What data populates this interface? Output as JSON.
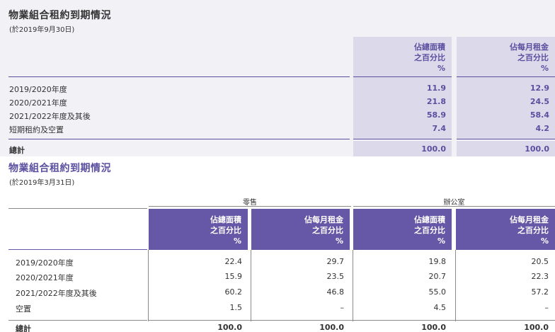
{
  "section1": {
    "title": "物業組合租約到期情況",
    "subtitle": "(於2019年9月30日)",
    "headers": [
      [
        "佔總面積",
        "之百分比",
        "%"
      ],
      [
        "佔每月租金",
        "之百分比",
        "%"
      ]
    ],
    "rows": [
      {
        "label": "2019/2020年度",
        "values": [
          "11.9",
          "12.9"
        ]
      },
      {
        "label": "2020/2021年度",
        "values": [
          "21.8",
          "24.5"
        ]
      },
      {
        "label": "2021/2022年度及其後",
        "values": [
          "58.9",
          "58.4"
        ]
      },
      {
        "label": "短期租約及空置",
        "values": [
          "7.4",
          "4.2"
        ]
      }
    ],
    "total": {
      "label": "總計",
      "values": [
        "100.0",
        "100.0"
      ]
    }
  },
  "section2": {
    "title": "物業組合租約到期情況",
    "subtitle": "(於2019年3月31日)",
    "groups": [
      "零售",
      "辦公室"
    ],
    "headers": [
      [
        "佔總面積",
        "之百分比",
        "%"
      ],
      [
        "佔每月租金",
        "之百分比",
        "%"
      ],
      [
        "佔總面積",
        "之百分比",
        "%"
      ],
      [
        "佔每月租金",
        "之百分比",
        "%"
      ]
    ],
    "rows": [
      {
        "label": "2019/2020年度",
        "values": [
          "22.4",
          "29.7",
          "19.8",
          "20.5"
        ]
      },
      {
        "label": "2020/2021年度",
        "values": [
          "15.9",
          "23.5",
          "20.7",
          "22.3"
        ]
      },
      {
        "label": "2021/2022年度及其後",
        "values": [
          "60.2",
          "46.8",
          "55.0",
          "57.2"
        ]
      },
      {
        "label": "空置",
        "values": [
          "1.5",
          "–",
          "4.5",
          "–"
        ]
      }
    ],
    "total": {
      "label": "總計",
      "values": [
        "100.0",
        "100.0",
        "100.0",
        "100.0"
      ]
    }
  }
}
